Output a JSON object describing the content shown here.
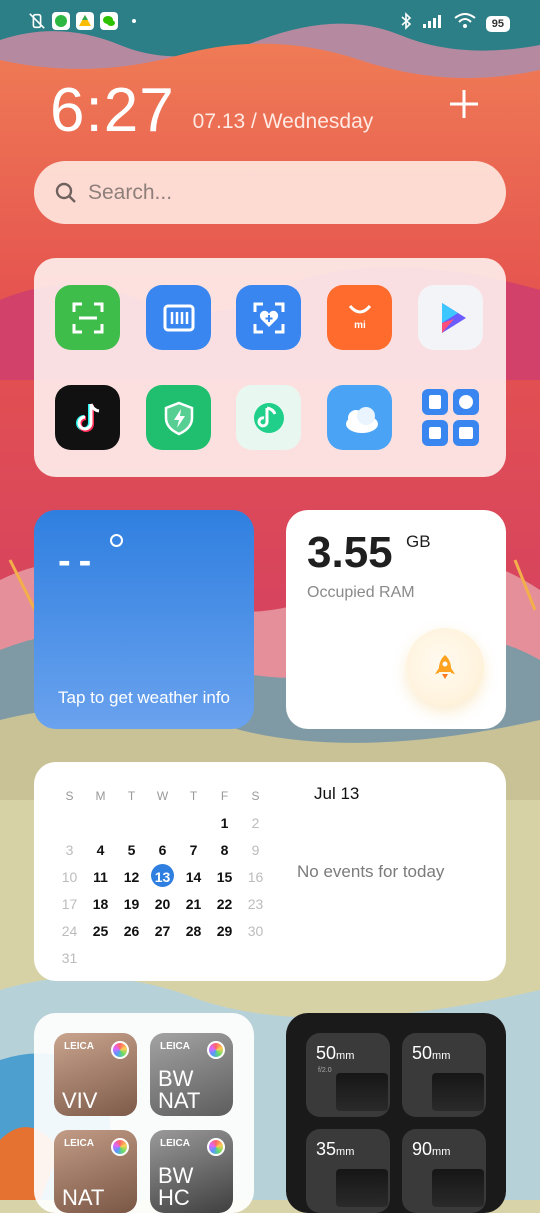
{
  "status_bar": {
    "left_icons": [
      "mute-vibrate-icon",
      "whatsapp-icon",
      "drive-icon",
      "wechat-icon"
    ],
    "right_icons": [
      "bluetooth-icon",
      "signal-icon",
      "wifi-icon"
    ],
    "battery": "95"
  },
  "clock": {
    "time": "6:27",
    "date": "07.13 / Wednesday"
  },
  "search": {
    "placeholder": "Search..."
  },
  "apps": [
    {
      "icon": "scanner-icon",
      "bg": "#3fbd4a"
    },
    {
      "icon": "barcode-icon",
      "bg": "#3a86f0"
    },
    {
      "icon": "health-scan-icon",
      "bg": "#3a86f0"
    },
    {
      "icon": "mi-store-icon",
      "bg": "#ff6b2c"
    },
    {
      "icon": "video-play-icon",
      "bg": "#f2f4f7"
    },
    {
      "icon": "tiktok-icon",
      "bg": "#111111"
    },
    {
      "icon": "security-icon",
      "bg": "#1fbf6f"
    },
    {
      "icon": "music-icon",
      "bg": "#e8f8f1"
    },
    {
      "icon": "weather-icon",
      "bg": "#4aa3f5"
    },
    {
      "icon": "tools-folder-icon",
      "bg": "#f2f4f7"
    }
  ],
  "weather": {
    "temp": "--",
    "message": "Tap to get weather info"
  },
  "ram": {
    "value": "3.55",
    "unit": "GB",
    "label": "Occupied RAM"
  },
  "calendar": {
    "weekdays": [
      "S",
      "M",
      "T",
      "W",
      "T",
      "F",
      "S"
    ],
    "weeks": [
      [
        "",
        "",
        "",
        "",
        "",
        "1",
        "2"
      ],
      [
        "3",
        "4",
        "5",
        "6",
        "7",
        "8",
        "9"
      ],
      [
        "10",
        "11",
        "12",
        "13",
        "14",
        "15",
        "16"
      ],
      [
        "17",
        "18",
        "19",
        "20",
        "21",
        "22",
        "23"
      ],
      [
        "24",
        "25",
        "26",
        "27",
        "28",
        "29",
        "30"
      ],
      [
        "31",
        "",
        "",
        "",
        "",
        "",
        ""
      ]
    ],
    "today": "13",
    "title": "Jul 13",
    "empty_text": "No events for today"
  },
  "leica_presets": [
    {
      "brand": "LEICA",
      "name": "VIV",
      "colors": [
        "#c9a48e",
        "#7d5a49"
      ]
    },
    {
      "brand": "LEICA",
      "name": "BW\nNAT",
      "colors": [
        "#a3a3a3",
        "#5d5d5d"
      ]
    },
    {
      "brand": "LEICA",
      "name": "NAT",
      "colors": [
        "#c29c86",
        "#7a5645"
      ]
    },
    {
      "brand": "LEICA",
      "name": "BW\nHC",
      "colors": [
        "#9a9a9a",
        "#3f3f3f"
      ]
    }
  ],
  "lenses": [
    {
      "focal": "50",
      "unit": "mm",
      "sub": "f/2.0"
    },
    {
      "focal": "50",
      "unit": "mm",
      "sub": ""
    },
    {
      "focal": "35",
      "unit": "mm",
      "sub": ""
    },
    {
      "focal": "90",
      "unit": "mm",
      "sub": ""
    }
  ]
}
